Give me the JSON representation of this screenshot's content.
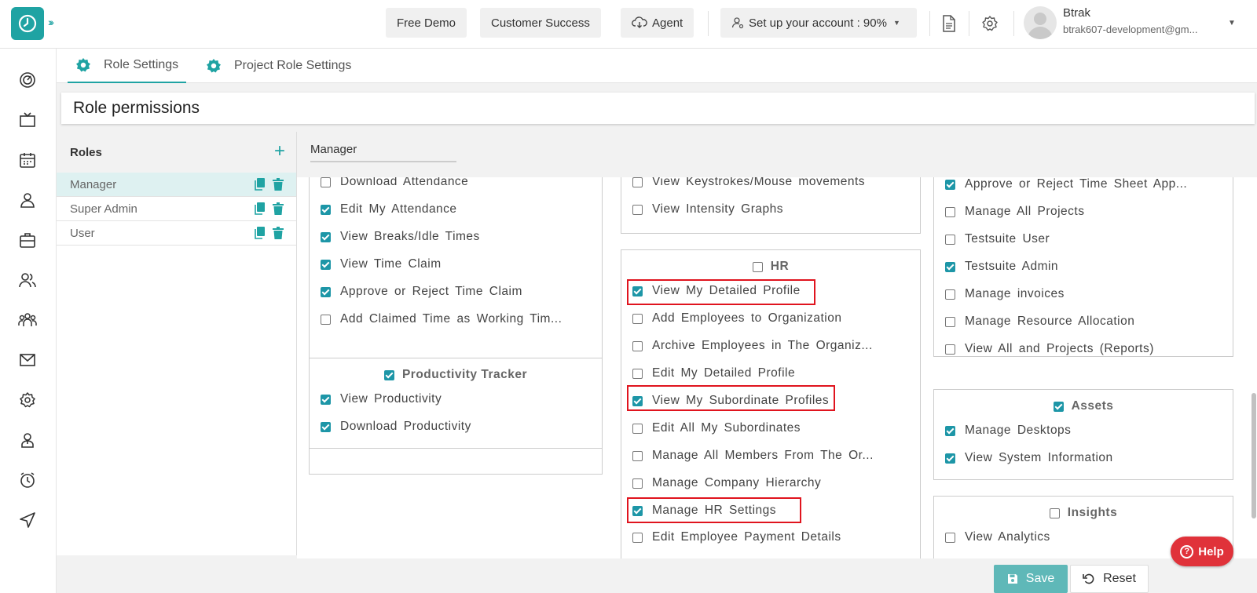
{
  "header": {
    "free_demo": "Free Demo",
    "customer_success": "Customer Success",
    "agent": "Agent",
    "setup": "Set up your account : 90%",
    "user_name": "Btrak",
    "user_email": "btrak607-development@gm..."
  },
  "tabs": [
    "Role Settings",
    "Project Role Settings"
  ],
  "page_title": "Role permissions",
  "roles": {
    "title": "Roles",
    "items": [
      "Manager",
      "Super Admin",
      "User"
    ]
  },
  "selected_role": "Manager",
  "col1": {
    "attendance": [
      {
        "label": "Download Attendance",
        "checked": false
      },
      {
        "label": "Edit My Attendance",
        "checked": true
      },
      {
        "label": "View Breaks/Idle Times",
        "checked": true
      },
      {
        "label": "View Time Claim",
        "checked": true
      },
      {
        "label": "Approve or Reject Time Claim",
        "checked": true
      },
      {
        "label": "Add Claimed Time as Working Tim...",
        "checked": false
      }
    ],
    "productivity": {
      "title": "Productivity Tracker",
      "checked": true,
      "items": [
        {
          "label": "View Productivity",
          "checked": true
        },
        {
          "label": "Download Productivity",
          "checked": true
        }
      ]
    }
  },
  "col2": {
    "activity": [
      {
        "label": "View Keystrokes/Mouse movements",
        "checked": false
      },
      {
        "label": "View Intensity Graphs",
        "checked": false
      }
    ],
    "hr": {
      "title": "HR",
      "checked": false,
      "items": [
        {
          "label": "View My Detailed Profile",
          "checked": true
        },
        {
          "label": "Add Employees to Organization",
          "checked": false
        },
        {
          "label": "Archive Employees in The Organiz...",
          "checked": false
        },
        {
          "label": "Edit My Detailed Profile",
          "checked": false
        },
        {
          "label": "View My Subordinate Profiles",
          "checked": true
        },
        {
          "label": "Edit All My Subordinates",
          "checked": false
        },
        {
          "label": "Manage All Members From The Or...",
          "checked": false
        },
        {
          "label": "Manage Company Hierarchy",
          "checked": false
        },
        {
          "label": "Manage HR Settings",
          "checked": true
        },
        {
          "label": "Edit Employee Payment Details",
          "checked": false
        }
      ]
    }
  },
  "col3": {
    "projects": [
      {
        "label": "Approve or Reject Time Sheet App...",
        "checked": true
      },
      {
        "label": "Manage All Projects",
        "checked": false
      },
      {
        "label": "Testsuite User",
        "checked": false
      },
      {
        "label": "Testsuite Admin",
        "checked": true
      },
      {
        "label": "Manage invoices",
        "checked": false
      },
      {
        "label": "Manage Resource Allocation",
        "checked": false
      },
      {
        "label": "View All and Projects (Reports)",
        "checked": false
      }
    ],
    "assets": {
      "title": "Assets",
      "checked": true,
      "items": [
        {
          "label": "Manage Desktops",
          "checked": true
        },
        {
          "label": "View System Information",
          "checked": true
        }
      ]
    },
    "insights": {
      "title": "Insights",
      "checked": false,
      "items": [
        {
          "label": "View Analytics",
          "checked": false
        }
      ]
    }
  },
  "help": "Help",
  "save": "Save",
  "reset": "Reset",
  "colors": {
    "accent": "#1fa3a3",
    "checkbox": "#1d96a7",
    "highlight": "#e0141e",
    "help": "#e0323a"
  }
}
